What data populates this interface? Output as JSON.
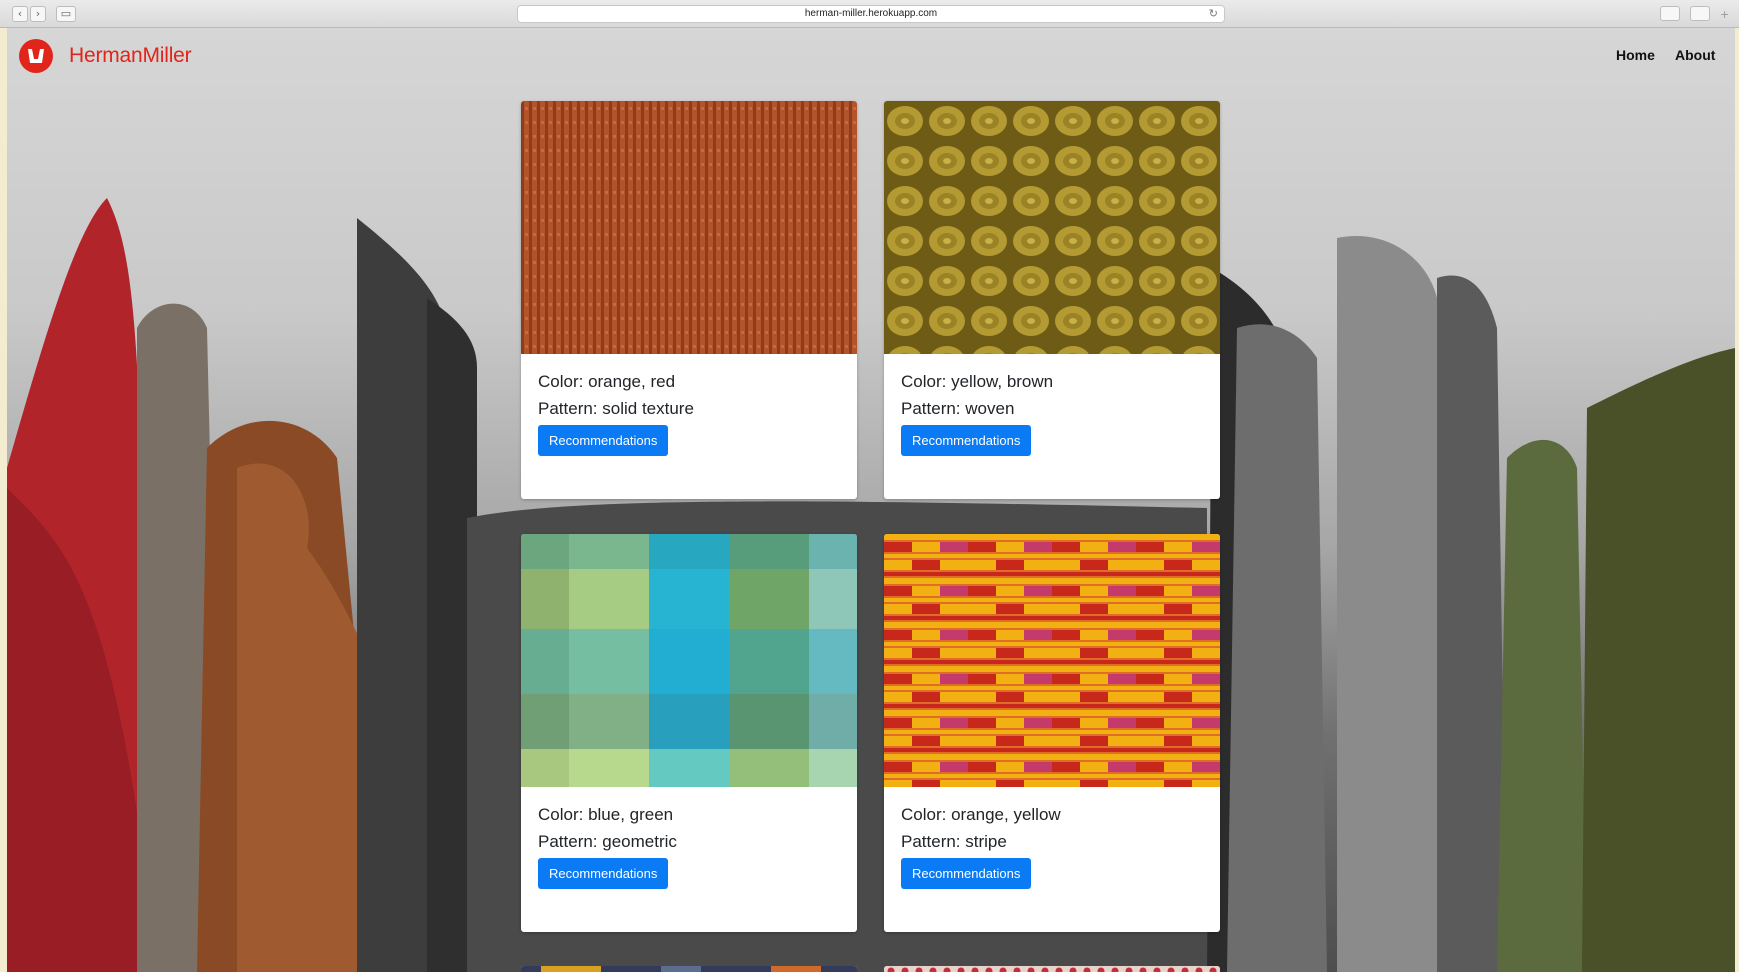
{
  "browser": {
    "url": "herman-miller.herokuapp.com"
  },
  "navbar": {
    "brand": "HermanMiller",
    "links": [
      {
        "label": "Home"
      },
      {
        "label": "About"
      }
    ]
  },
  "cards": [
    {
      "color": "Color: orange, red",
      "pattern": "Pattern: solid texture",
      "button": "Recommendations",
      "swatch_colors": [
        "#b3532b",
        "#8c3e1c"
      ]
    },
    {
      "color": "Color: yellow, brown",
      "pattern": "Pattern: woven",
      "button": "Recommendations",
      "swatch_colors": [
        "#b39a33",
        "#6e5c16"
      ]
    },
    {
      "color": "Color: blue, green",
      "pattern": "Pattern: geometric",
      "button": "Recommendations",
      "swatch_colors": [
        "#27b4d2",
        "#7aaa6c",
        "#a6cc84"
      ]
    },
    {
      "color": "Color: orange, yellow",
      "pattern": "Pattern: stripe",
      "button": "Recommendations",
      "swatch_colors": [
        "#f2b013",
        "#c8281b",
        "#e06d25"
      ]
    }
  ],
  "theme": {
    "brand_color": "#e1251b",
    "button_color": "#0a7bf5"
  }
}
